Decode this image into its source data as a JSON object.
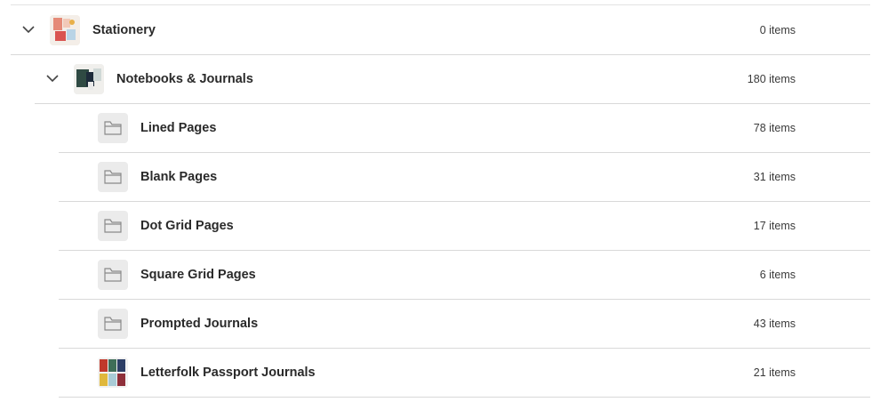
{
  "categories": [
    {
      "name": "Stationery",
      "count": "0 items",
      "expanded": true,
      "icon": "stationery-thumbnail"
    },
    {
      "name": "Notebooks & Journals",
      "count": "180 items",
      "expanded": true,
      "icon": "notebooks-thumbnail"
    },
    {
      "name": "Lined Pages",
      "count": "78 items",
      "icon": "folder-icon"
    },
    {
      "name": "Blank Pages",
      "count": "31 items",
      "icon": "folder-icon"
    },
    {
      "name": "Dot Grid Pages",
      "count": "17 items",
      "icon": "folder-icon"
    },
    {
      "name": "Square Grid Pages",
      "count": "6 items",
      "icon": "folder-icon"
    },
    {
      "name": "Prompted Journals",
      "count": "43 items",
      "icon": "folder-icon"
    },
    {
      "name": "Letterfolk Passport Journals",
      "count": "21 items",
      "icon": "passport-journals-thumbnail"
    }
  ]
}
